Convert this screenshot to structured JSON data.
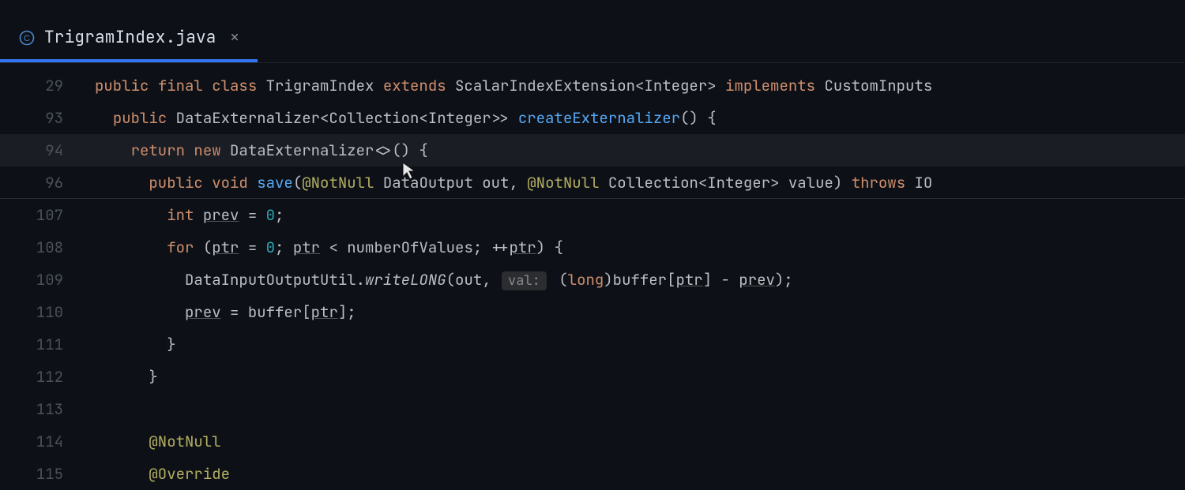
{
  "tab": {
    "filename": "TrigramIndex.java"
  },
  "lines": [
    {
      "num": "29",
      "indent": 0,
      "tokens": [
        {
          "t": "public ",
          "c": "kw"
        },
        {
          "t": "final ",
          "c": "kw"
        },
        {
          "t": "class ",
          "c": "kw"
        },
        {
          "t": "TrigramIndex ",
          "c": "type"
        },
        {
          "t": "extends ",
          "c": "kw"
        },
        {
          "t": "ScalarIndexExtension<Integer> ",
          "c": "type"
        },
        {
          "t": "implements ",
          "c": "kw"
        },
        {
          "t": "CustomInputs",
          "c": "type"
        }
      ]
    },
    {
      "num": "93",
      "indent": 1,
      "tokens": [
        {
          "t": "public ",
          "c": "kw"
        },
        {
          "t": "DataExternalizer<Collection<Integer>> ",
          "c": "type"
        },
        {
          "t": "createExternalizer",
          "c": "methoddecl"
        },
        {
          "t": "() {",
          "c": "punct"
        }
      ]
    },
    {
      "num": "94",
      "indent": 2,
      "hl": true,
      "tokens": [
        {
          "t": "return ",
          "c": "kw"
        },
        {
          "t": "new ",
          "c": "kw"
        },
        {
          "t": "DataExternalizer<>() {",
          "c": "type"
        }
      ]
    },
    {
      "num": "96",
      "indent": 3,
      "sep": true,
      "tokens": [
        {
          "t": "public ",
          "c": "kw"
        },
        {
          "t": "void ",
          "c": "kw"
        },
        {
          "t": "save",
          "c": "methoddecl"
        },
        {
          "t": "(",
          "c": "punct"
        },
        {
          "t": "@NotNull ",
          "c": "anno"
        },
        {
          "t": "DataOutput out, ",
          "c": "type"
        },
        {
          "t": "@NotNull ",
          "c": "anno"
        },
        {
          "t": "Collection<Integer> value) ",
          "c": "type"
        },
        {
          "t": "throws ",
          "c": "kw"
        },
        {
          "t": "IO",
          "c": "type"
        }
      ]
    },
    {
      "num": "107",
      "indent": 4,
      "tokens": [
        {
          "t": "int ",
          "c": "kw"
        },
        {
          "t": "prev",
          "c": "id ul"
        },
        {
          "t": " = ",
          "c": "punct"
        },
        {
          "t": "0",
          "c": "num"
        },
        {
          "t": ";",
          "c": "punct"
        }
      ]
    },
    {
      "num": "108",
      "indent": 4,
      "tokens": [
        {
          "t": "for ",
          "c": "kw"
        },
        {
          "t": "(",
          "c": "punct"
        },
        {
          "t": "ptr",
          "c": "id ul"
        },
        {
          "t": " = ",
          "c": "punct"
        },
        {
          "t": "0",
          "c": "num"
        },
        {
          "t": "; ",
          "c": "punct"
        },
        {
          "t": "ptr",
          "c": "id ul"
        },
        {
          "t": " < numberOfValues; ++",
          "c": "id"
        },
        {
          "t": "ptr",
          "c": "id ul"
        },
        {
          "t": ") {",
          "c": "punct"
        }
      ]
    },
    {
      "num": "109",
      "indent": 5,
      "tokens": [
        {
          "t": "DataInputOutputUtil.",
          "c": "type"
        },
        {
          "t": "writeLONG",
          "c": "call"
        },
        {
          "t": "(out, ",
          "c": "id"
        },
        {
          "hint": "val:"
        },
        {
          "t": " (",
          "c": "punct"
        },
        {
          "t": "long",
          "c": "kw"
        },
        {
          "t": ")buffer[",
          "c": "id"
        },
        {
          "t": "ptr",
          "c": "id ul"
        },
        {
          "t": "] - ",
          "c": "id"
        },
        {
          "t": "prev",
          "c": "id ul"
        },
        {
          "t": ");",
          "c": "punct"
        }
      ]
    },
    {
      "num": "110",
      "indent": 5,
      "tokens": [
        {
          "t": "prev",
          "c": "id ul"
        },
        {
          "t": " = buffer[",
          "c": "id"
        },
        {
          "t": "ptr",
          "c": "id ul"
        },
        {
          "t": "];",
          "c": "punct"
        }
      ]
    },
    {
      "num": "111",
      "indent": 4,
      "tokens": [
        {
          "t": "}",
          "c": "punct"
        }
      ]
    },
    {
      "num": "112",
      "indent": 3,
      "tokens": [
        {
          "t": "}",
          "c": "punct"
        }
      ]
    },
    {
      "num": "113",
      "indent": 0,
      "tokens": []
    },
    {
      "num": "114",
      "indent": 3,
      "tokens": [
        {
          "t": "@NotNull",
          "c": "anno"
        }
      ]
    },
    {
      "num": "115",
      "indent": 3,
      "cut": true,
      "tokens": [
        {
          "t": "@Override",
          "c": "anno"
        }
      ]
    }
  ]
}
